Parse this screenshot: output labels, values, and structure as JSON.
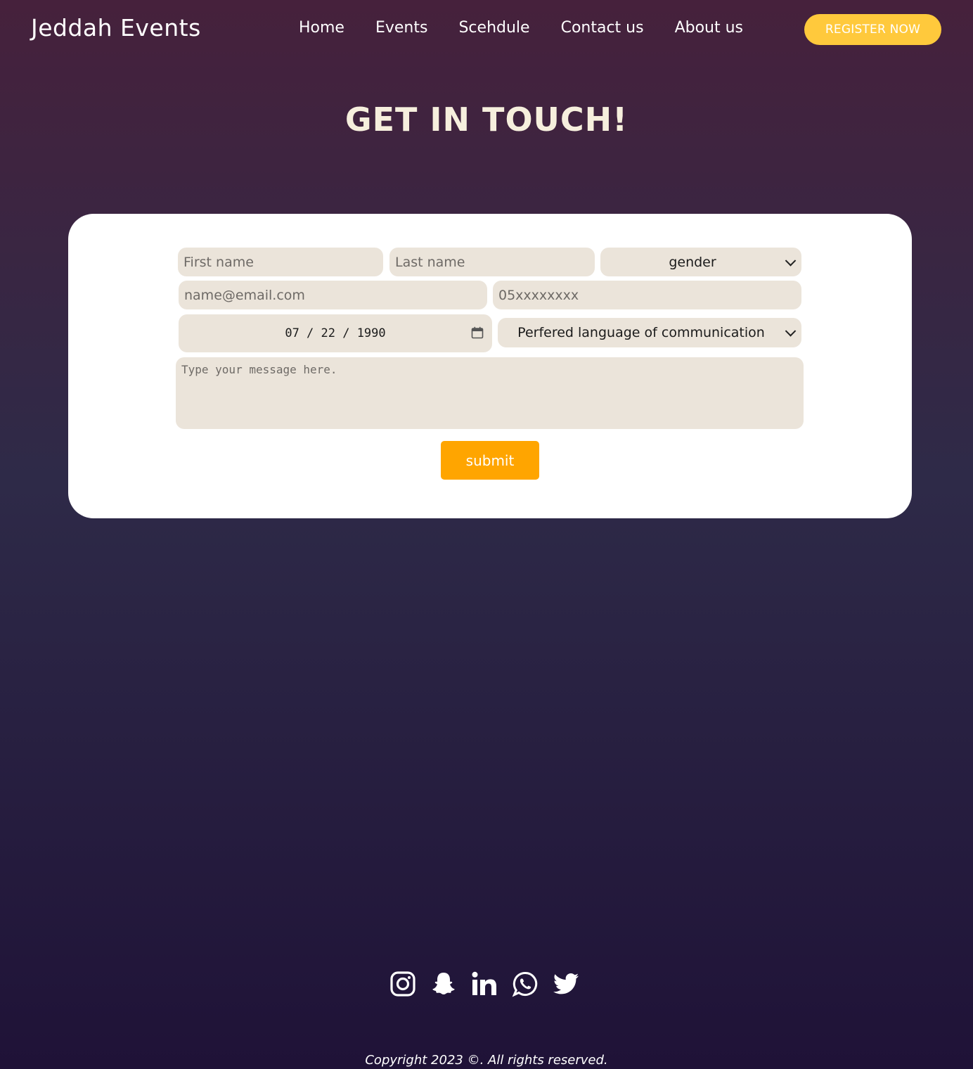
{
  "header": {
    "brand": "Jeddah Events",
    "nav": [
      "Home",
      "Events",
      "Scehdule",
      "Contact us",
      "About us"
    ],
    "register_label": "REGISTER NOW"
  },
  "page": {
    "title": "GET IN TOUCH!"
  },
  "form": {
    "first_name_placeholder": "First name",
    "last_name_placeholder": "Last name",
    "gender_selected": "gender",
    "email_placeholder": "name@email.com",
    "phone_placeholder": "05xxxxxxxx",
    "birth_date_value": "07 / 22 / 1990",
    "language_selected": "Perfered language of communication",
    "message_placeholder": "Type your message here.",
    "submit_label": "submit"
  },
  "footer": {
    "social_icons": [
      "instagram-icon",
      "snapchat-icon",
      "linkedin-icon",
      "whatsapp-icon",
      "twitter-icon"
    ],
    "copyright": "Copyright 2023 ©. All rights reserved."
  },
  "colors": {
    "accent": "#ffc93c",
    "submit": "#ffa500",
    "field_bg": "#ebe4da",
    "title": "#f6efdd"
  }
}
